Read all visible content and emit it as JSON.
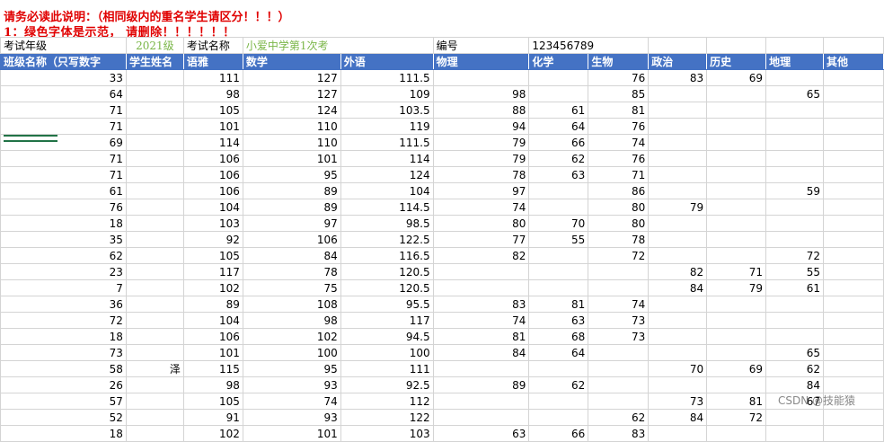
{
  "notice": {
    "line1": "请务必读此说明：（相同级内的重名学生请区分！！！）",
    "line2": "1：绿色字体是示范，  请删除！！！！！！"
  },
  "meta": {
    "grade_label": "考试年级",
    "grade_value": "2021级",
    "exam_name_label": "考试名称",
    "exam_name_value": "小爱中学第1次考",
    "code_label": "编号",
    "code_value": "123456789"
  },
  "headers": [
    "班级名称（只写数字",
    "学生姓名",
    "语雅",
    "数学",
    "外语",
    "物理",
    "化学",
    "生物",
    "政治",
    "历史",
    "地理",
    "其他"
  ],
  "rows": [
    [
      "33",
      "",
      "111",
      "127",
      "111.5",
      "",
      "",
      "76",
      "83",
      "69",
      "",
      ""
    ],
    [
      "64",
      "",
      "98",
      "127",
      "109",
      "98",
      "",
      "85",
      "",
      "",
      "65",
      ""
    ],
    [
      "71",
      "",
      "105",
      "124",
      "103.5",
      "88",
      "61",
      "81",
      "",
      "",
      "",
      ""
    ],
    [
      "71",
      "",
      "101",
      "110",
      "119",
      "94",
      "64",
      "76",
      "",
      "",
      "",
      ""
    ],
    [
      "69",
      "",
      "114",
      "110",
      "111.5",
      "79",
      "66",
      "74",
      "",
      "",
      "",
      ""
    ],
    [
      "71",
      "",
      "106",
      "101",
      "114",
      "79",
      "62",
      "76",
      "",
      "",
      "",
      ""
    ],
    [
      "71",
      "",
      "106",
      "95",
      "124",
      "78",
      "63",
      "71",
      "",
      "",
      "",
      ""
    ],
    [
      "61",
      "",
      "106",
      "89",
      "104",
      "97",
      "",
      "86",
      "",
      "",
      "59",
      ""
    ],
    [
      "76",
      "",
      "104",
      "89",
      "114.5",
      "74",
      "",
      "80",
      "79",
      "",
      "",
      ""
    ],
    [
      "18",
      "",
      "103",
      "97",
      "98.5",
      "80",
      "70",
      "80",
      "",
      "",
      "",
      ""
    ],
    [
      "35",
      "",
      "92",
      "106",
      "122.5",
      "77",
      "55",
      "78",
      "",
      "",
      "",
      ""
    ],
    [
      "62",
      "",
      "105",
      "84",
      "116.5",
      "82",
      "",
      "72",
      "",
      "",
      "72",
      ""
    ],
    [
      "23",
      "",
      "117",
      "78",
      "120.5",
      "",
      "",
      "",
      "82",
      "71",
      "55",
      ""
    ],
    [
      "7",
      "",
      "102",
      "75",
      "120.5",
      "",
      "",
      "",
      "84",
      "79",
      "61",
      ""
    ],
    [
      "36",
      "",
      "89",
      "108",
      "95.5",
      "83",
      "81",
      "74",
      "",
      "",
      "",
      ""
    ],
    [
      "72",
      "",
      "104",
      "98",
      "117",
      "74",
      "63",
      "73",
      "",
      "",
      "",
      ""
    ],
    [
      "18",
      "",
      "106",
      "102",
      "94.5",
      "81",
      "68",
      "73",
      "",
      "",
      "",
      ""
    ],
    [
      "73",
      "",
      "101",
      "100",
      "100",
      "84",
      "64",
      "",
      "",
      "",
      "65",
      ""
    ],
    [
      "58",
      "泽",
      "115",
      "95",
      "111",
      "",
      "",
      "",
      "70",
      "69",
      "62",
      ""
    ],
    [
      "26",
      "",
      "98",
      "93",
      "92.5",
      "89",
      "62",
      "",
      "",
      "",
      "84",
      ""
    ],
    [
      "57",
      "",
      "105",
      "74",
      "112",
      "",
      "",
      "",
      "73",
      "81",
      "67",
      ""
    ],
    [
      "52",
      "",
      "91",
      "93",
      "122",
      "",
      "",
      "62",
      "84",
      "72",
      "",
      ""
    ],
    [
      "18",
      "",
      "102",
      "101",
      "103",
      "63",
      "66",
      "83",
      "",
      "",
      "",
      ""
    ]
  ],
  "watermark": "CSDN @技能猿"
}
